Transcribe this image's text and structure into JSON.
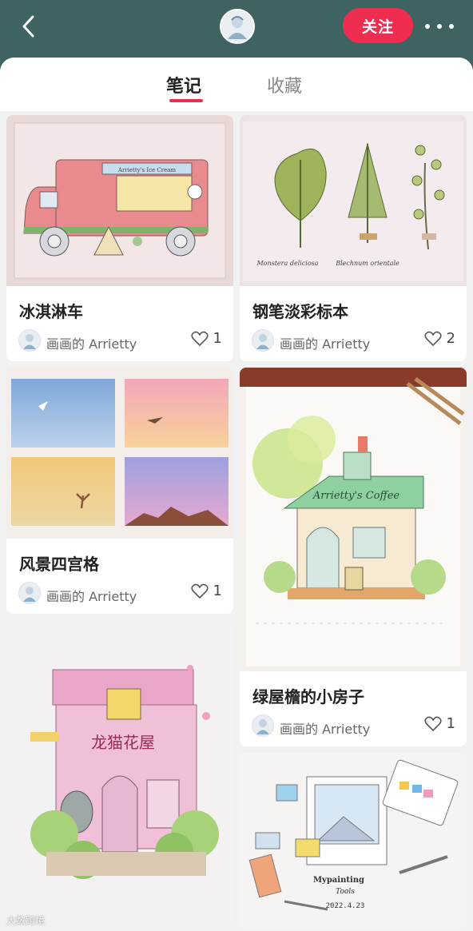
{
  "header": {
    "follow_label": "关注",
    "colors": {
      "bar": "#3f6361",
      "follow": "#ef2d50"
    }
  },
  "tabs": [
    {
      "label": "笔记",
      "active": true
    },
    {
      "label": "收藏",
      "active": false
    }
  ],
  "notes": [
    {
      "title": "冰淇淋车",
      "author": "画画的 Arrietty",
      "likes": "1",
      "illustration": "ice-cream-truck",
      "art_text": "Arrietty's Ice Cream"
    },
    {
      "title": "钢笔淡彩标本",
      "author": "画画的 Arrietty",
      "likes": "2",
      "illustration": "leaf-specimens",
      "art_text": [
        "Monstera deliciosa",
        "Blechnum orientale"
      ]
    },
    {
      "title": "风景四宫格",
      "author": "画画的 Arrietty",
      "likes": "1",
      "illustration": "four-landscapes"
    },
    {
      "title": "绿屋檐的小房子",
      "author": "画画的 Arrietty",
      "likes": "1",
      "illustration": "green-roof-house",
      "art_text": "Arrietty's Coffee"
    },
    {
      "title": "",
      "author": "",
      "likes": "",
      "illustration": "totoro-flower-shop",
      "art_text": "龙猫花屋"
    },
    {
      "title": "",
      "author": "",
      "likes": "",
      "illustration": "painting-tools",
      "art_text": [
        "Mypainting",
        "Tools",
        "2022.4.23"
      ]
    }
  ],
  "watermark": "大数跨境"
}
